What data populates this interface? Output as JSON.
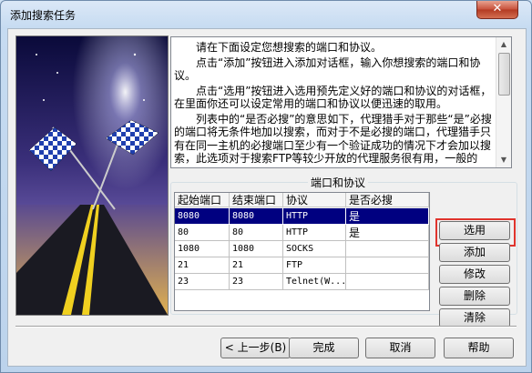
{
  "window": {
    "title": "添加搜索任务",
    "close_label": "✕"
  },
  "description": {
    "paragraphs": [
      "请在下面设定您想搜索的端口和协议。",
      "点击“添加”按钮进入添加对话框，输入你想搜索的端口和协议。",
      "点击“选用”按钮进入选用预先定义好的端口和协议的对话框，在里面你还可以设定常用的端口和协议以便迅速的取用。",
      "列表中的“是否必搜”的意思如下，代理猎手对于那些“是”必搜的端口将无条件地加以搜索，而对于不是必搜的端口，代理猎手只有在同一主机的必搜端口至少有一个验证成功的情况下才会加以搜索，此选项对于搜索FTP等较少开放的代理服务很有用，一般的"
    ]
  },
  "ports_group": {
    "title": "端口和协议",
    "columns": [
      "起始端口",
      "结束端口",
      "协议",
      "是否必搜"
    ],
    "rows": [
      {
        "start": "8080",
        "end": "8080",
        "protocol": "HTTP",
        "required": "是",
        "selected": true
      },
      {
        "start": "80",
        "end": "80",
        "protocol": "HTTP",
        "required": "是",
        "selected": false
      },
      {
        "start": "1080",
        "end": "1080",
        "protocol": "SOCKS",
        "required": "",
        "selected": false
      },
      {
        "start": "21",
        "end": "21",
        "protocol": "FTP",
        "required": "",
        "selected": false
      },
      {
        "start": "23",
        "end": "23",
        "protocol": "Telnet(W...",
        "required": "",
        "selected": false
      }
    ]
  },
  "side_buttons": {
    "select": "选用",
    "add": "添加",
    "modify": "修改",
    "delete": "删除",
    "clear": "清除"
  },
  "bottom_buttons": {
    "back": "< 上一步(B)",
    "finish": "完成",
    "cancel": "取消",
    "help": "帮助"
  },
  "colors": {
    "selected_row": "#000080",
    "highlight": "#e0342d"
  }
}
